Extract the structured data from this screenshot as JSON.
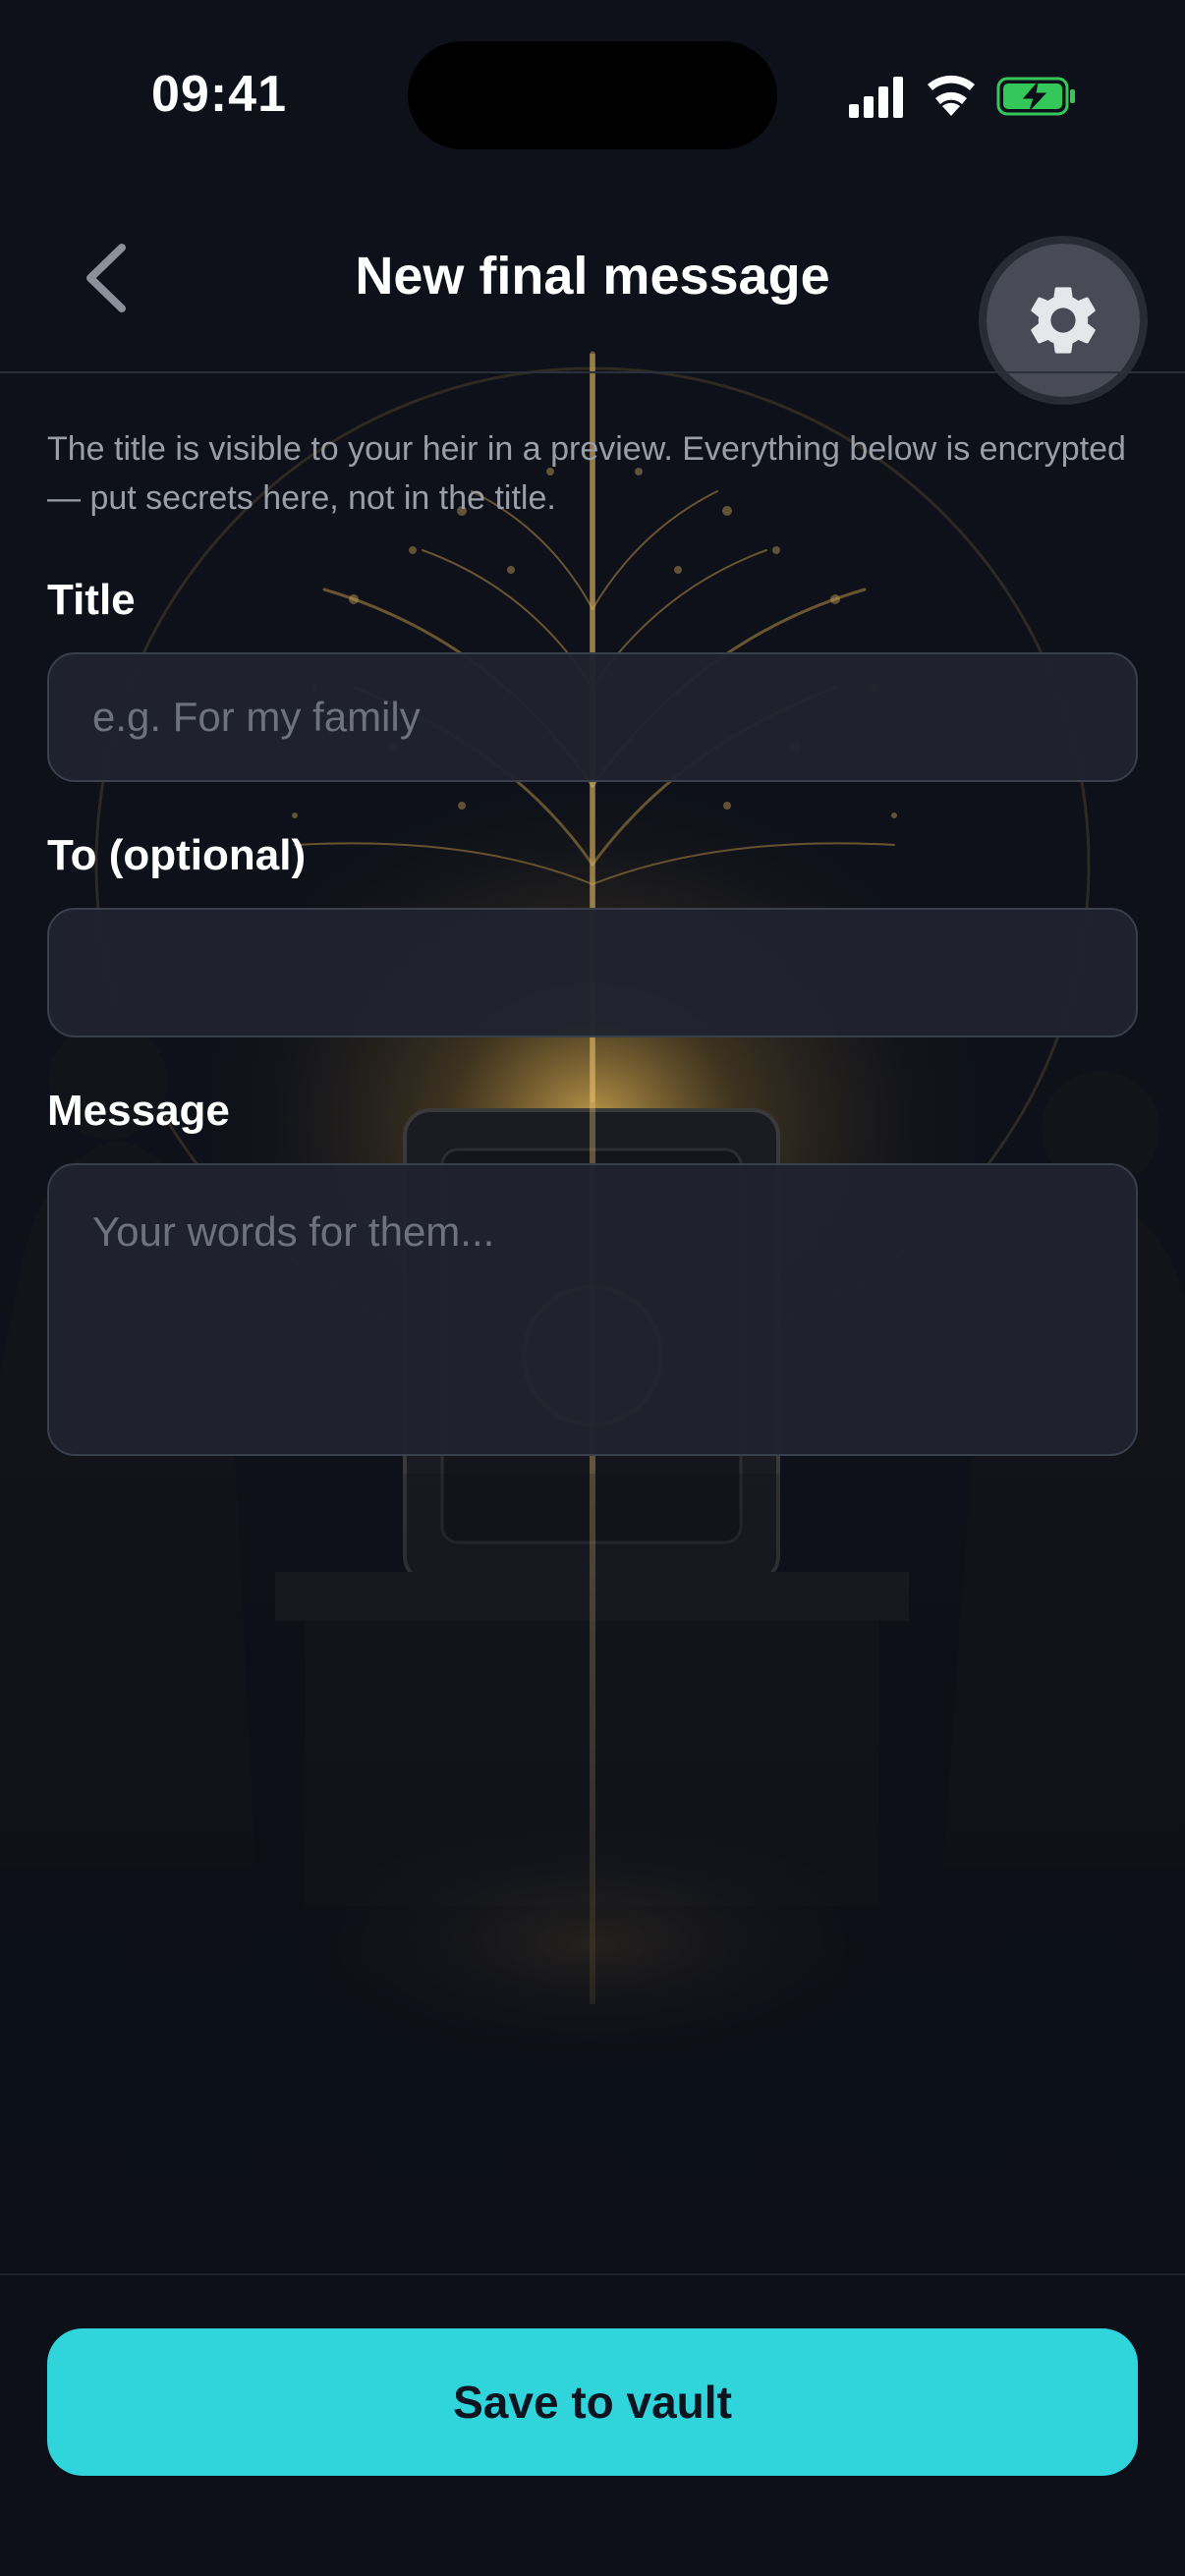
{
  "status_bar": {
    "time": "09:41",
    "icons": [
      "signal-icon",
      "wifi-icon",
      "battery-charging-icon"
    ]
  },
  "header": {
    "title": "New final message",
    "back_icon": "chevron-left-icon",
    "settings_icon": "gear-icon"
  },
  "form": {
    "helper_text": "The title is visible to your heir in a preview. Everything below is encrypted — put secrets here, not in the title.",
    "title": {
      "label": "Title",
      "value": "",
      "placeholder": "e.g. For my family"
    },
    "to": {
      "label": "To (optional)",
      "value": "",
      "placeholder": ""
    },
    "message": {
      "label": "Message",
      "value": "",
      "placeholder": "Your words for them..."
    }
  },
  "actions": {
    "save_label": "Save to vault"
  },
  "colors": {
    "background": "#0c0f18",
    "accent": "#30d5dc",
    "field_bg": "#20232e",
    "battery_green": "#34c759"
  }
}
